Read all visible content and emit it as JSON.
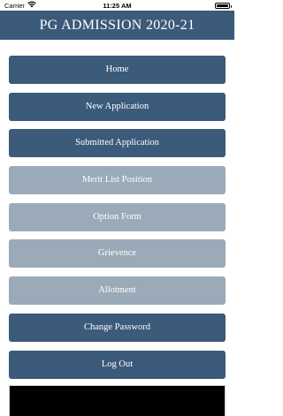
{
  "status_bar": {
    "carrier": "Carrier",
    "time": "11:25 AM",
    "battery_level": 1.0,
    "wifi_icon": "wifi-icon",
    "battery_icon": "battery-icon"
  },
  "header": {
    "title": "PG ADMISSION 2020-21",
    "background_color": "#3c5a7a"
  },
  "menu": {
    "items": [
      {
        "label": "Home",
        "enabled": true
      },
      {
        "label": "New Application",
        "enabled": true
      },
      {
        "label": "Submitted Application",
        "enabled": true
      },
      {
        "label": "Merit List Position",
        "enabled": false
      },
      {
        "label": "Option Form",
        "enabled": false
      },
      {
        "label": "Grievence",
        "enabled": false
      },
      {
        "label": "Allotment",
        "enabled": false
      },
      {
        "label": "Change Password",
        "enabled": true
      },
      {
        "label": "Log Out",
        "enabled": true
      }
    ],
    "active_color": "#3c5a7a",
    "disabled_color": "#9aaab9"
  }
}
